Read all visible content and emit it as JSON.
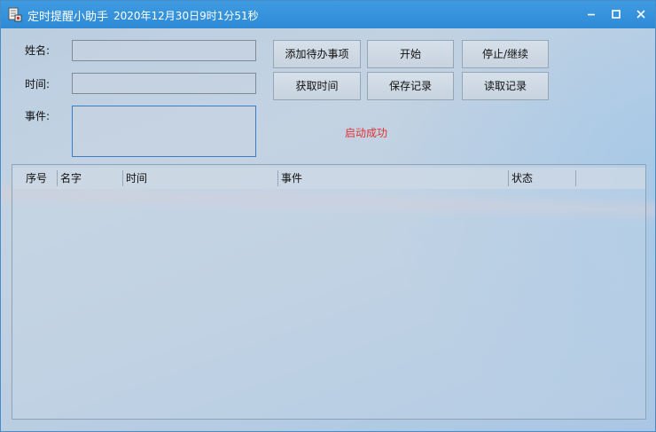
{
  "window": {
    "title": "定时提醒小助手",
    "clock": "2020年12月30日9时1分51秒",
    "minimize": "—",
    "maximize": "□",
    "close": "✕"
  },
  "form": {
    "name_label": "姓名:",
    "time_label": "时间:",
    "event_label": "事件:",
    "name_value": "",
    "time_value": "",
    "event_value": ""
  },
  "buttons": {
    "add_todo": "添加待办事项",
    "start": "开始",
    "stop_continue": "停止/继续",
    "get_time": "获取时间",
    "save_record": "保存记录",
    "read_record": "读取记录"
  },
  "status": {
    "text": "启动成功",
    "color": "#d33333"
  },
  "list": {
    "columns": [
      "序号",
      "名字",
      "时间",
      "事件",
      "状态"
    ],
    "rows": []
  },
  "colors": {
    "titlebar": "#2d8ad6",
    "accent_border": "#3c7cc4"
  }
}
